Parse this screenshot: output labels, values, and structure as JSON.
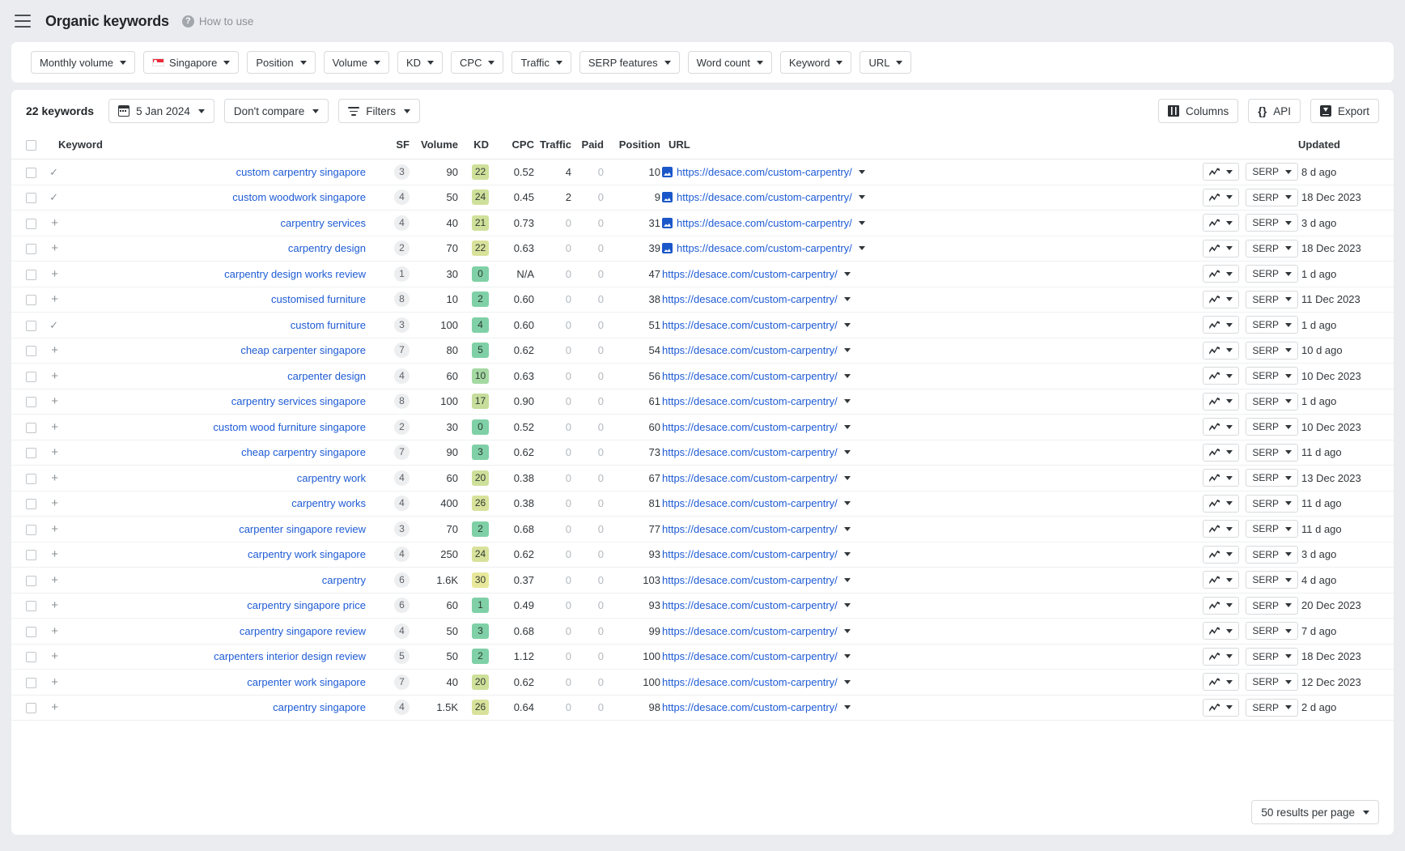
{
  "header": {
    "title": "Organic keywords",
    "how_to_use": "How to use",
    "menu_icon": "hamburger-icon",
    "help_icon": "question-circle-icon"
  },
  "filters": [
    {
      "label": "Monthly volume",
      "icon": null
    },
    {
      "label": "Singapore",
      "icon": "singapore-flag-icon"
    },
    {
      "label": "Position",
      "icon": null
    },
    {
      "label": "Volume",
      "icon": null
    },
    {
      "label": "KD",
      "icon": null
    },
    {
      "label": "CPC",
      "icon": null
    },
    {
      "label": "Traffic",
      "icon": null
    },
    {
      "label": "SERP features",
      "icon": null
    },
    {
      "label": "Word count",
      "icon": null
    },
    {
      "label": "Keyword",
      "icon": null
    },
    {
      "label": "URL",
      "icon": null
    }
  ],
  "toolbar": {
    "keyword_count": "22 keywords",
    "date": "5 Jan 2024",
    "compare": "Don't compare",
    "filters": "Filters",
    "columns": "Columns",
    "api": "API",
    "export": "Export"
  },
  "table": {
    "columns": [
      "Keyword",
      "SF",
      "Volume",
      "KD",
      "CPC",
      "Traffic",
      "Paid",
      "Position",
      "URL",
      "Updated"
    ],
    "url_label": "https://desace.com/custom-carpentry/",
    "serp_button": "SERP",
    "rows": [
      {
        "state": "tick",
        "keyword": "custom carpentry singapore",
        "sf": "3",
        "volume": "90",
        "kd": "22",
        "kd_color": "#cfe09a",
        "cpc": "0.52",
        "traffic": "4",
        "paid": "0",
        "position": "10",
        "has_serp_icon": true,
        "updated": "8 d ago"
      },
      {
        "state": "tick",
        "keyword": "custom woodwork singapore",
        "sf": "4",
        "volume": "50",
        "kd": "24",
        "kd_color": "#cfe09a",
        "cpc": "0.45",
        "traffic": "2",
        "paid": "0",
        "position": "9",
        "has_serp_icon": true,
        "updated": "18 Dec 2023"
      },
      {
        "state": "plus",
        "keyword": "carpentry services",
        "sf": "4",
        "volume": "40",
        "kd": "21",
        "kd_color": "#cfe09a",
        "cpc": "0.73",
        "traffic": "0",
        "paid": "0",
        "position": "31",
        "has_serp_icon": true,
        "updated": "3 d ago"
      },
      {
        "state": "plus",
        "keyword": "carpentry design",
        "sf": "2",
        "volume": "70",
        "kd": "22",
        "kd_color": "#d8e29b",
        "cpc": "0.63",
        "traffic": "0",
        "paid": "0",
        "position": "39",
        "has_serp_icon": true,
        "updated": "18 Dec 2023"
      },
      {
        "state": "plus",
        "keyword": "carpentry design works review",
        "sf": "1",
        "volume": "30",
        "kd": "0",
        "kd_color": "#7fd0a6",
        "cpc": "N/A",
        "traffic": "0",
        "paid": "0",
        "position": "47",
        "has_serp_icon": false,
        "updated": "1 d ago"
      },
      {
        "state": "plus",
        "keyword": "customised furniture",
        "sf": "8",
        "volume": "10",
        "kd": "2",
        "kd_color": "#7fd0a6",
        "cpc": "0.60",
        "traffic": "0",
        "paid": "0",
        "position": "38",
        "has_serp_icon": false,
        "updated": "11 Dec 2023"
      },
      {
        "state": "tick",
        "keyword": "custom furniture",
        "sf": "3",
        "volume": "100",
        "kd": "4",
        "kd_color": "#7fd0a6",
        "cpc": "0.60",
        "traffic": "0",
        "paid": "0",
        "position": "51",
        "has_serp_icon": false,
        "updated": "1 d ago"
      },
      {
        "state": "plus",
        "keyword": "cheap carpenter singapore",
        "sf": "7",
        "volume": "80",
        "kd": "5",
        "kd_color": "#7fd0a6",
        "cpc": "0.62",
        "traffic": "0",
        "paid": "0",
        "position": "54",
        "has_serp_icon": false,
        "updated": "10 d ago"
      },
      {
        "state": "plus",
        "keyword": "carpenter design",
        "sf": "4",
        "volume": "60",
        "kd": "10",
        "kd_color": "#a5d9a2",
        "cpc": "0.63",
        "traffic": "0",
        "paid": "0",
        "position": "56",
        "has_serp_icon": false,
        "updated": "10 Dec 2023"
      },
      {
        "state": "plus",
        "keyword": "carpentry services singapore",
        "sf": "8",
        "volume": "100",
        "kd": "17",
        "kd_color": "#c6dd9c",
        "cpc": "0.90",
        "traffic": "0",
        "paid": "0",
        "position": "61",
        "has_serp_icon": false,
        "updated": "1 d ago"
      },
      {
        "state": "plus",
        "keyword": "custom wood furniture singapore",
        "sf": "2",
        "volume": "30",
        "kd": "0",
        "kd_color": "#7fd0a6",
        "cpc": "0.52",
        "traffic": "0",
        "paid": "0",
        "position": "60",
        "has_serp_icon": false,
        "updated": "10 Dec 2023"
      },
      {
        "state": "plus",
        "keyword": "cheap carpentry singapore",
        "sf": "7",
        "volume": "90",
        "kd": "3",
        "kd_color": "#7fd0a6",
        "cpc": "0.62",
        "traffic": "0",
        "paid": "0",
        "position": "73",
        "has_serp_icon": false,
        "updated": "11 d ago"
      },
      {
        "state": "plus",
        "keyword": "carpentry work",
        "sf": "4",
        "volume": "60",
        "kd": "20",
        "kd_color": "#cfe09a",
        "cpc": "0.38",
        "traffic": "0",
        "paid": "0",
        "position": "67",
        "has_serp_icon": false,
        "updated": "13 Dec 2023"
      },
      {
        "state": "plus",
        "keyword": "carpentry works",
        "sf": "4",
        "volume": "400",
        "kd": "26",
        "kd_color": "#d8e29b",
        "cpc": "0.38",
        "traffic": "0",
        "paid": "0",
        "position": "81",
        "has_serp_icon": false,
        "updated": "11 d ago"
      },
      {
        "state": "plus",
        "keyword": "carpenter singapore review",
        "sf": "3",
        "volume": "70",
        "kd": "2",
        "kd_color": "#7fd0a6",
        "cpc": "0.68",
        "traffic": "0",
        "paid": "0",
        "position": "77",
        "has_serp_icon": false,
        "updated": "11 d ago"
      },
      {
        "state": "plus",
        "keyword": "carpentry work singapore",
        "sf": "4",
        "volume": "250",
        "kd": "24",
        "kd_color": "#d8e29b",
        "cpc": "0.62",
        "traffic": "0",
        "paid": "0",
        "position": "93",
        "has_serp_icon": false,
        "updated": "3 d ago"
      },
      {
        "state": "plus",
        "keyword": "carpentry",
        "sf": "6",
        "volume": "1.6K",
        "kd": "30",
        "kd_color": "#e8e89b",
        "cpc": "0.37",
        "traffic": "0",
        "paid": "0",
        "position": "103",
        "has_serp_icon": false,
        "updated": "4 d ago"
      },
      {
        "state": "plus",
        "keyword": "carpentry singapore price",
        "sf": "6",
        "volume": "60",
        "kd": "1",
        "kd_color": "#7fd0a6",
        "cpc": "0.49",
        "traffic": "0",
        "paid": "0",
        "position": "93",
        "has_serp_icon": false,
        "updated": "20 Dec 2023"
      },
      {
        "state": "plus",
        "keyword": "carpentry singapore review",
        "sf": "4",
        "volume": "50",
        "kd": "3",
        "kd_color": "#7fd0a6",
        "cpc": "0.68",
        "traffic": "0",
        "paid": "0",
        "position": "99",
        "has_serp_icon": false,
        "updated": "7 d ago"
      },
      {
        "state": "plus",
        "keyword": "carpenters interior design review",
        "sf": "5",
        "volume": "50",
        "kd": "2",
        "kd_color": "#7fd0a6",
        "cpc": "1.12",
        "traffic": "0",
        "paid": "0",
        "position": "100",
        "has_serp_icon": false,
        "updated": "18 Dec 2023"
      },
      {
        "state": "plus",
        "keyword": "carpenter work singapore",
        "sf": "7",
        "volume": "40",
        "kd": "20",
        "kd_color": "#cfe09a",
        "cpc": "0.62",
        "traffic": "0",
        "paid": "0",
        "position": "100",
        "has_serp_icon": false,
        "updated": "12 Dec 2023"
      },
      {
        "state": "plus",
        "keyword": "carpentry singapore",
        "sf": "4",
        "volume": "1.5K",
        "kd": "26",
        "kd_color": "#d8e29b",
        "cpc": "0.64",
        "traffic": "0",
        "paid": "0",
        "position": "98",
        "has_serp_icon": false,
        "updated": "2 d ago"
      }
    ]
  },
  "footer": {
    "results_per_page": "50 results per page"
  },
  "colors": {
    "link": "#1e5bd4",
    "page_bg": "#ebecef",
    "card_bg": "#ffffff"
  }
}
